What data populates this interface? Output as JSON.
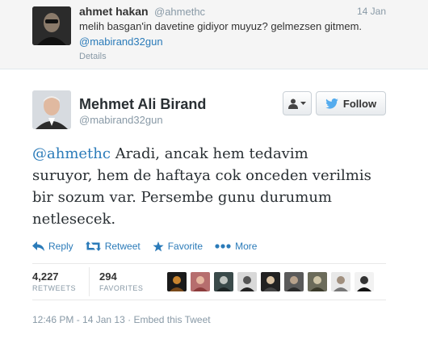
{
  "reply": {
    "name": "ahmet hakan",
    "handle": "@ahmethc",
    "time": "14 Jan",
    "text": "melih basgan'in davetine gidiyor muyuz? gelmezsen gitmem.",
    "mention": "@mabirand32gun",
    "details_label": "Details"
  },
  "tweet": {
    "name": "Mehmet Ali Birand",
    "handle": "@mabirand32gun",
    "mention": "@ahmethc",
    "text": "Aradi, ancak hem tedavim suruyor, hem de haftaya cok onceden verilmis bir sozum var. Persembe gunu durumum netlesecek.",
    "follow_label": "Follow"
  },
  "actions": {
    "reply": "Reply",
    "retweet": "Retweet",
    "favorite": "Favorite",
    "more": "More"
  },
  "stats": {
    "retweets_count": "4,227",
    "retweets_label": "RETWEETS",
    "favorites_count": "294",
    "favorites_label": "FAVORITES"
  },
  "footer": {
    "timestamp": "12:46 PM - 14 Jan 13",
    "separator": "·",
    "embed_label": "Embed this Tweet"
  },
  "colors": {
    "link": "#2b7bb9",
    "muted": "#8899a6",
    "twitter_bird": "#55acee"
  },
  "icons": {
    "reply": "reply-arrow-icon",
    "retweet": "retweet-icon",
    "favorite": "star-icon",
    "more": "ellipsis-icon",
    "follow": "twitter-bird-icon",
    "user_menu": "user-icon"
  }
}
